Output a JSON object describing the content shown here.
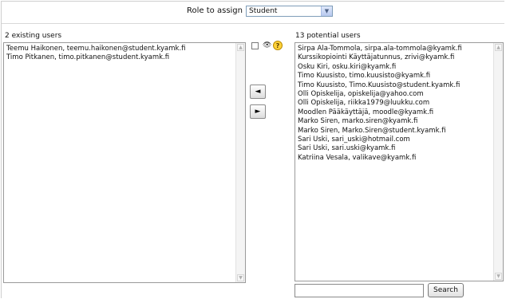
{
  "role": {
    "label": "Role to assign",
    "selected": "Student"
  },
  "existing": {
    "heading": "2 existing users",
    "users": [
      "Teemu Haikonen, teemu.haikonen@student.kyamk.fi",
      "Timo Pitkanen, timo.pitkanen@student.kyamk.fi"
    ]
  },
  "hidden_toggle": {
    "icon": "eye-icon",
    "help_icon": "help-icon",
    "help_glyph": "?"
  },
  "move_buttons": {
    "add_glyph": "◄",
    "remove_glyph": "►"
  },
  "potential": {
    "heading": "13 potential users",
    "users": [
      "Sirpa Ala-Tommola, sirpa.ala-tommola@kyamk.fi",
      "Kurssikopiointi Käyttäjatunnus, zrivi@kyamk.fi",
      "Osku Kiri, osku.kiri@kyamk.fi",
      "Timo Kuusisto, timo.kuusisto@kyamk.fi",
      "Timo Kuusisto, Timo.Kuusisto@student.kyamk.fi",
      "Olli Opiskelija, opiskelija@yahoo.com",
      "Olli Opiskelija, riikka1979@luukku.com",
      "Moodlen Pääkäyttäjä, moodle@kyamk.fi",
      "Marko Siren, marko.siren@kyamk.fi",
      "Marko Siren, Marko.Siren@student.kyamk.fi",
      "Sari Uski, sari_uski@hotmail.com",
      "Sari Uski, sari.uski@kyamk.fi",
      "Katriina Vesala, valikave@kyamk.fi"
    ]
  },
  "search": {
    "value": "",
    "button_label": "Search"
  }
}
